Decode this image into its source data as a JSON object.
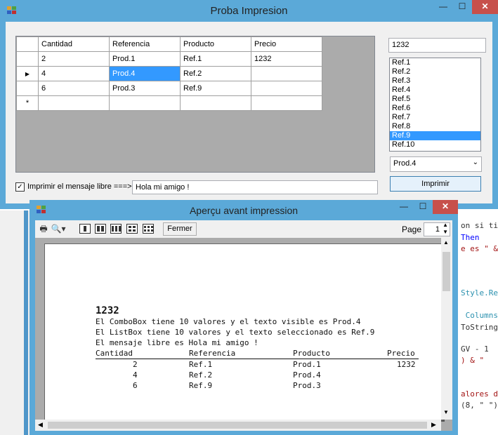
{
  "main_window": {
    "title": "Proba Impresion",
    "grid": {
      "headers": [
        "Cantidad",
        "Referencia",
        "Producto",
        "Precio"
      ],
      "rows": [
        [
          "2",
          "Prod.1",
          "Ref.1",
          "1232"
        ],
        [
          "4",
          "Prod.4",
          "Ref.2",
          ""
        ],
        [
          "6",
          "Prod.3",
          "Ref.9",
          ""
        ]
      ],
      "current_row_marker": "▶",
      "new_row_marker": "*"
    },
    "textbox_value": "1232",
    "listbox_items": [
      "Ref.1",
      "Ref.2",
      "Ref.3",
      "Ref.4",
      "Ref.5",
      "Ref.6",
      "Ref.7",
      "Ref.8",
      "Ref.9",
      "Ref.10"
    ],
    "listbox_selected": "Ref.9",
    "combobox_value": "Prod.4",
    "checkbox_label": "Imprimir el mensaje libre ===>",
    "checkbox_checked": "✓",
    "message_value": "Hola mi amigo !",
    "print_button": "Imprimir"
  },
  "preview_window": {
    "title": "Aperçu avant impression",
    "close_label": "Fermer",
    "page_label": "Page",
    "page_value": "1",
    "doc": {
      "heading": "1232",
      "line1": "El ComboBox tiene 10 valores y el texto visible es Prod.4",
      "line2": "El ListBox tiene 10 valores y el texto seleccionado es Ref.9",
      "line3": "El mensaje libre es Hola mi amigo !",
      "table_headers": [
        "Cantidad",
        "Referencia",
        "Producto",
        "Precio"
      ],
      "table_rows": [
        [
          "2",
          "Ref.1",
          "Prod.1",
          "1232"
        ],
        [
          "4",
          "Ref.2",
          "Prod.4",
          ""
        ],
        [
          "6",
          "Ref.9",
          "Prod.3",
          ""
        ]
      ]
    }
  },
  "editor_lines": [
    "on si ti",
    "Then",
    "e es \" &",
    "",
    "",
    "Style.Re",
    "",
    " Columns",
    "ToString",
    "",
    "GV - 1",
    ") & \"",
    "",
    "alores d",
    "(8, \" \")"
  ],
  "colors": {
    "title_bar": "#5ba9d8",
    "selection": "#3399ff",
    "close_button": "#c7504b"
  }
}
